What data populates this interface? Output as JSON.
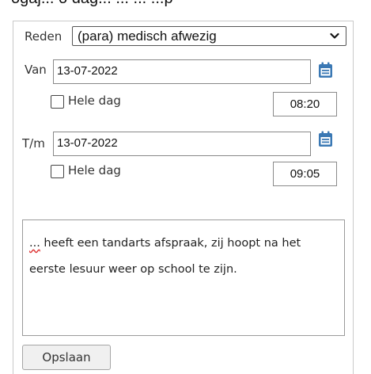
{
  "header": {
    "partial_text": "ogaj... o dag... ... ... ...p"
  },
  "form": {
    "reason_label": "Reden",
    "reason_value": "(para) medisch afwezig",
    "from_label": "Van",
    "from_date": "13-07-2022",
    "from_whole_day_label": "Hele dag",
    "from_time": "08:20",
    "until_label": "T/m",
    "until_date": "13-07-2022",
    "until_whole_day_label": "Hele dag",
    "until_time": "09:05",
    "comment_prefix": "...",
    "comment_text": " heeft een tandarts afspraak, zij hoopt na het eerste lesuur weer op school te zijn.",
    "save_label": "Opslaan"
  },
  "colors": {
    "calendar_icon": "#3a78b4",
    "border": "#888888"
  },
  "icons": {
    "calendar": "calendar-icon",
    "dropdown": "chevron-down-icon"
  }
}
